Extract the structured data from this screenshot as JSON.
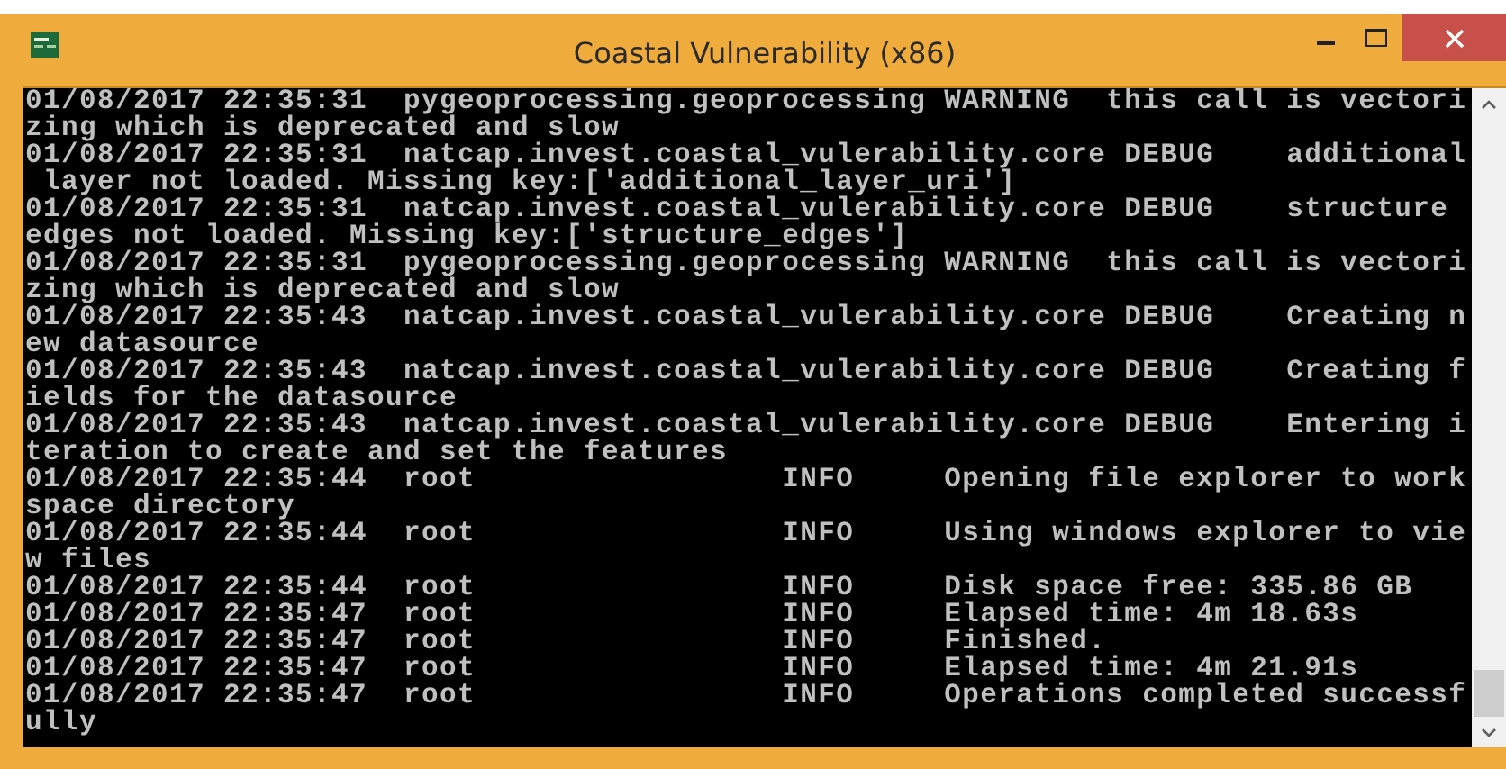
{
  "window": {
    "title": "Coastal Vulnerability (x86)"
  },
  "console": {
    "lines": [
      "01/08/2017 22:35:31  pygeoprocessing.geoprocessing WARNING  this call is vectori",
      "zing which is deprecated and slow",
      "01/08/2017 22:35:31  natcap.invest.coastal_vulerability.core DEBUG    additional",
      " layer not loaded. Missing key:['additional_layer_uri']",
      "01/08/2017 22:35:31  natcap.invest.coastal_vulerability.core DEBUG    structure",
      "edges not loaded. Missing key:['structure_edges']",
      "01/08/2017 22:35:31  pygeoprocessing.geoprocessing WARNING  this call is vectori",
      "zing which is deprecated and slow",
      "01/08/2017 22:35:43  natcap.invest.coastal_vulerability.core DEBUG    Creating n",
      "ew datasource",
      "01/08/2017 22:35:43  natcap.invest.coastal_vulerability.core DEBUG    Creating f",
      "ields for the datasource",
      "01/08/2017 22:35:43  natcap.invest.coastal_vulerability.core DEBUG    Entering i",
      "teration to create and set the features",
      "01/08/2017 22:35:44  root                 INFO     Opening file explorer to work",
      "space directory",
      "01/08/2017 22:35:44  root                 INFO     Using windows explorer to vie",
      "w files",
      "01/08/2017 22:35:44  root                 INFO     Disk space free: 335.86 GB",
      "01/08/2017 22:35:47  root                 INFO     Elapsed time: 4m 18.63s",
      "01/08/2017 22:35:47  root                 INFO     Finished.",
      "01/08/2017 22:35:47  root                 INFO     Elapsed time: 4m 21.91s",
      "01/08/2017 22:35:47  root                 INFO     Operations completed successf",
      "ully"
    ]
  }
}
